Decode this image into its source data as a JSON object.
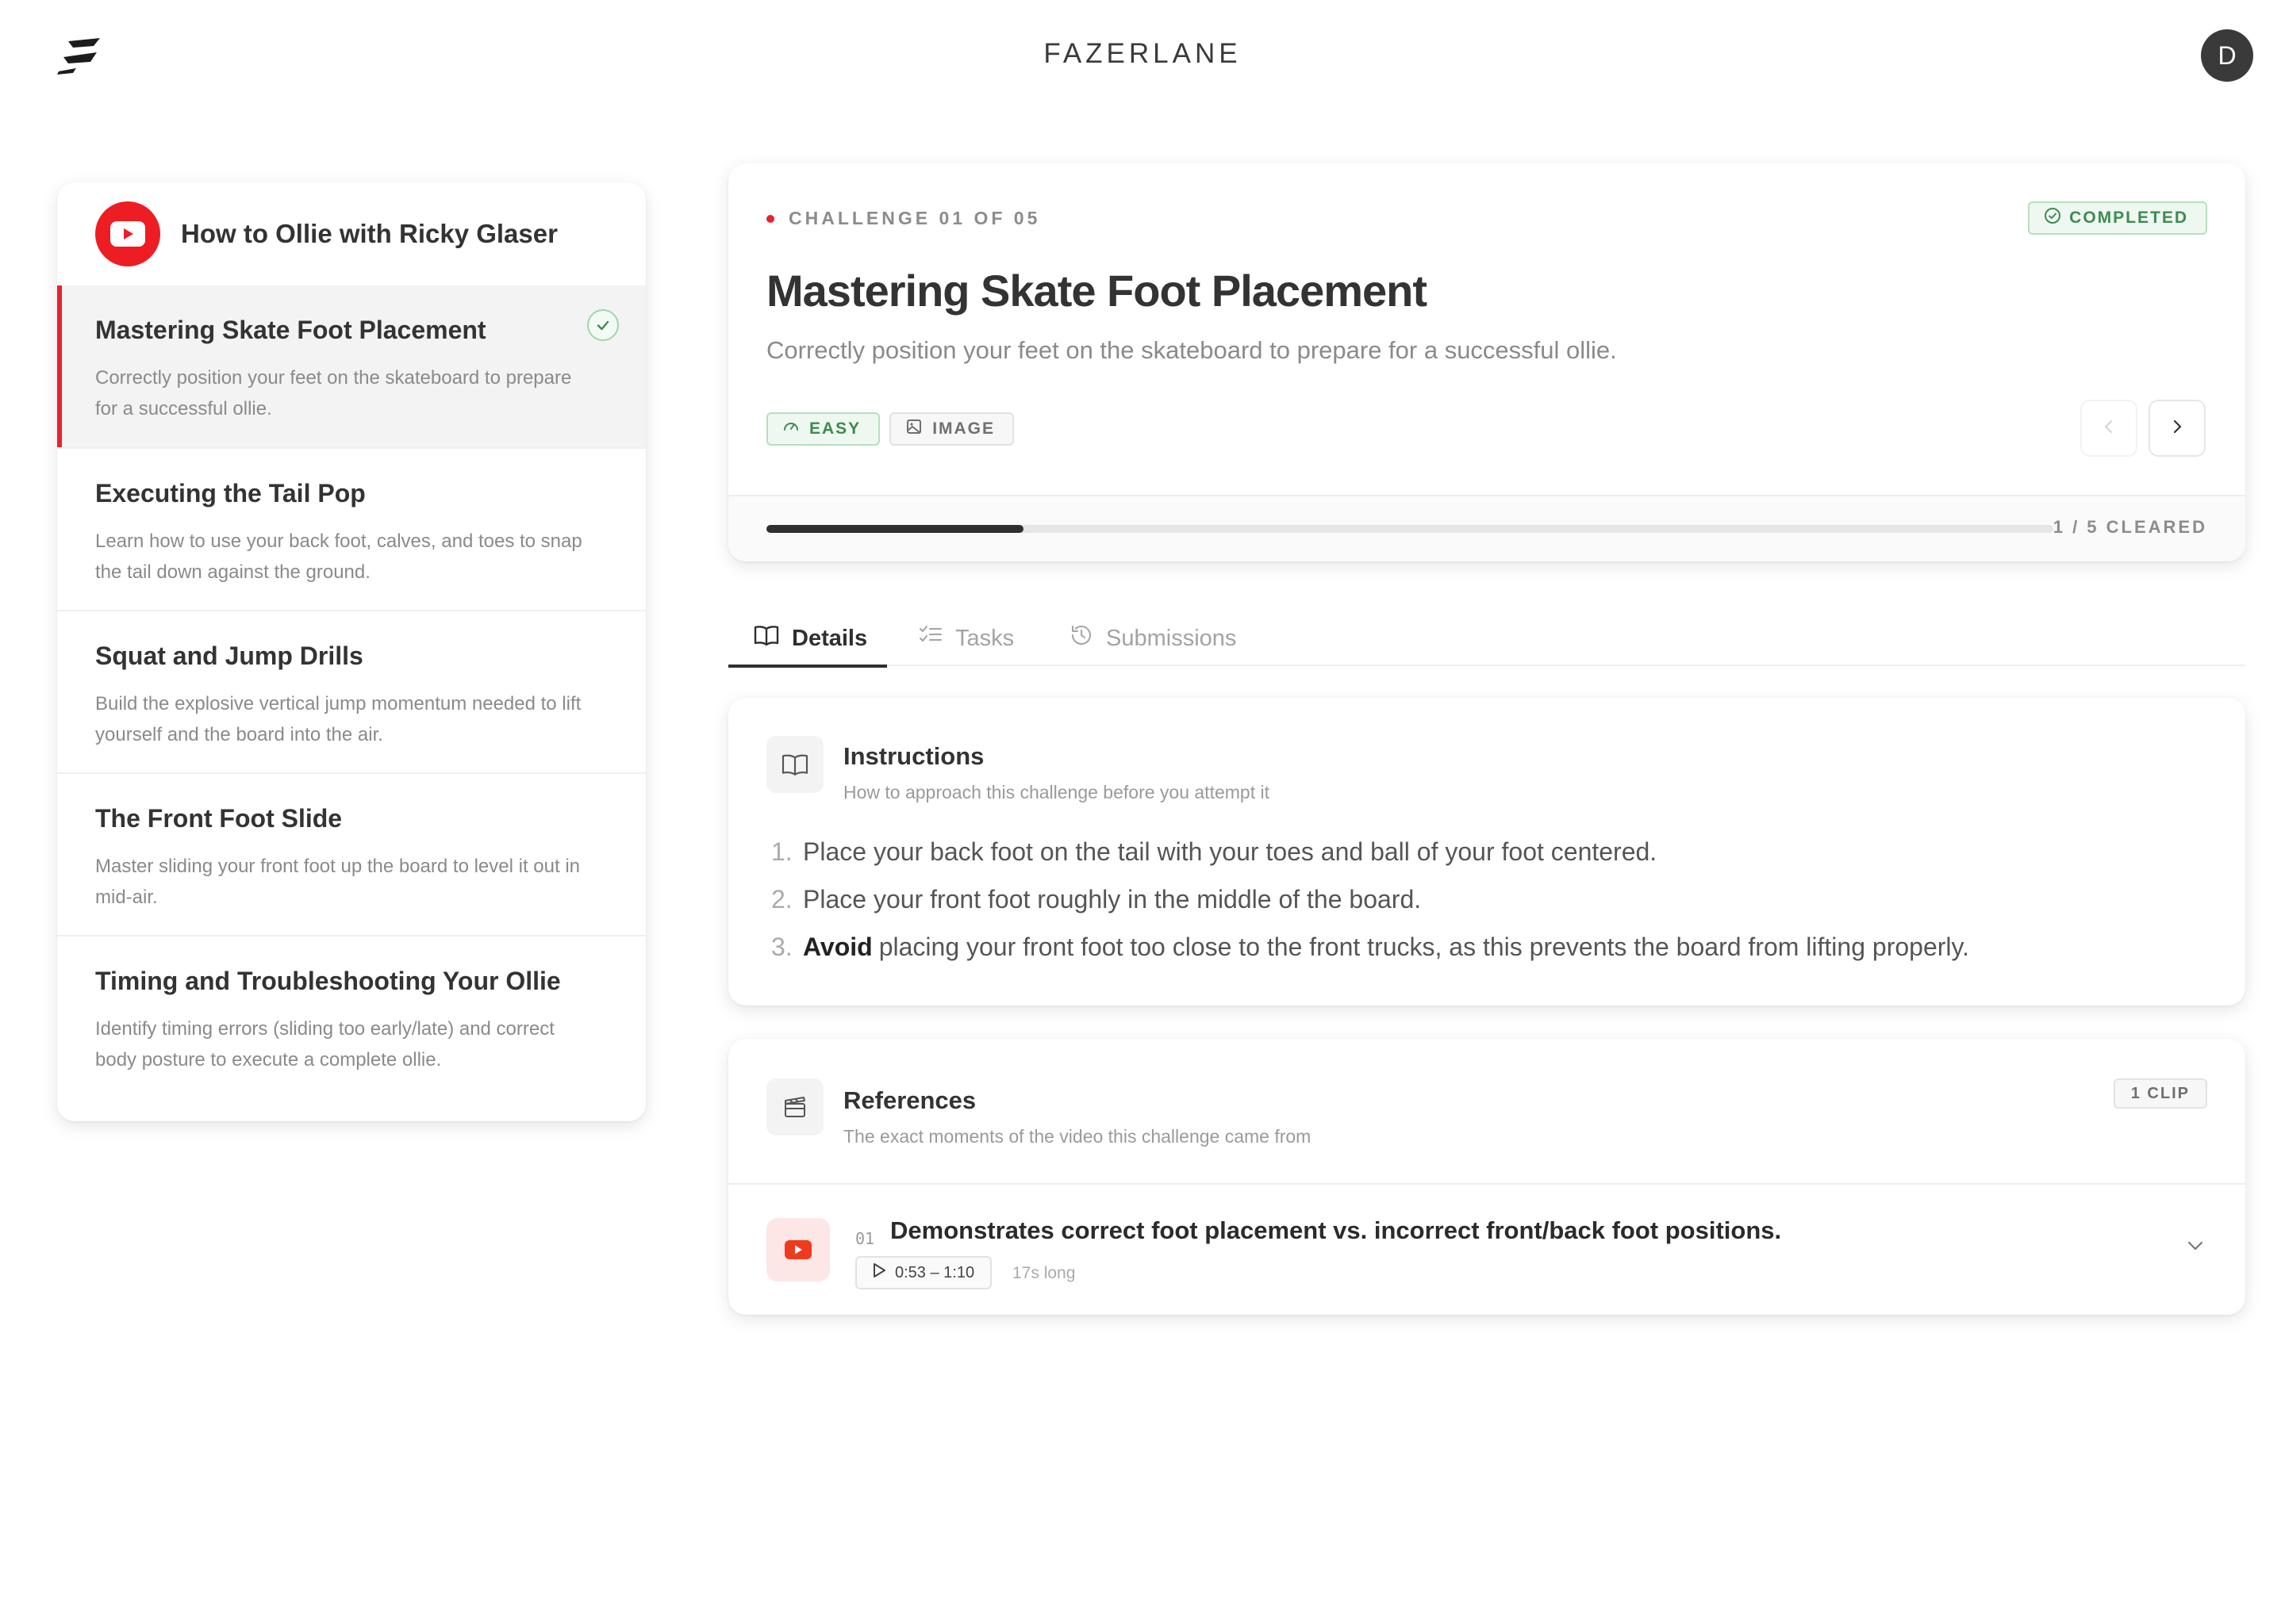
{
  "header": {
    "brand": "FAZERLANE",
    "avatar_initial": "D"
  },
  "sidebar": {
    "course_title": "How to Ollie with Ricky Glaser",
    "items": [
      {
        "title": "Mastering Skate Foot Placement",
        "desc": "Correctly position your feet on the skateboard to prepare for a successful ollie.",
        "completed": true,
        "active": true
      },
      {
        "title": "Executing the Tail Pop",
        "desc": "Learn how to use your back foot, calves, and toes to snap the tail down against the ground."
      },
      {
        "title": "Squat and Jump Drills",
        "desc": "Build the explosive vertical jump momentum needed to lift yourself and the board into the air."
      },
      {
        "title": "The Front Foot Slide",
        "desc": "Master sliding your front foot up the board to level it out in mid-air."
      },
      {
        "title": "Timing and Troubleshooting Your Ollie",
        "desc": "Identify timing errors (sliding too early/late) and correct body posture to execute a complete ollie."
      }
    ]
  },
  "challenge": {
    "eyebrow": "CHALLENGE 01 OF 05",
    "status": "COMPLETED",
    "title": "Mastering Skate Foot Placement",
    "description": "Correctly position your feet on the skateboard to prepare for a successful ollie.",
    "tags": {
      "difficulty": "EASY",
      "media": "IMAGE"
    },
    "progress_fraction": 0.2,
    "progress_label": "1 / 5 CLEARED"
  },
  "tabs": {
    "details": "Details",
    "tasks": "Tasks",
    "submissions": "Submissions"
  },
  "instructions": {
    "title": "Instructions",
    "subtitle": "How to approach this challenge before you attempt it",
    "steps": [
      {
        "num": "1.",
        "bold": "",
        "text": "Place your back foot on the tail with your toes and ball of your foot centered."
      },
      {
        "num": "2.",
        "bold": "",
        "text": "Place your front foot roughly in the middle of the board."
      },
      {
        "num": "3.",
        "bold": "Avoid",
        "text": "placing your front foot too close to the front trucks, as this prevents the board from lifting properly."
      }
    ]
  },
  "references": {
    "title": "References",
    "subtitle": "The exact moments of the video this challenge came from",
    "clip_count": "1 CLIP",
    "clips": [
      {
        "num": "01",
        "title": "Demonstrates correct foot placement vs. incorrect front/back foot positions.",
        "time_range": "0:53 – 1:10",
        "duration": "17s long"
      }
    ]
  },
  "colors": {
    "accent_red": "#e8232c",
    "youtube_red": "#ee1d23",
    "success_green": "#3f8a52",
    "text_dark": "#2f2f2f"
  },
  "icons": [
    "fazerlane-logo-icon",
    "youtube-icon",
    "check-icon",
    "check-circle-icon",
    "gauge-icon",
    "image-icon",
    "chevron-left-icon",
    "chevron-right-icon",
    "book-open-icon",
    "tasks-list-icon",
    "history-icon",
    "clapperboard-icon",
    "play-icon",
    "chevron-down-icon"
  ]
}
